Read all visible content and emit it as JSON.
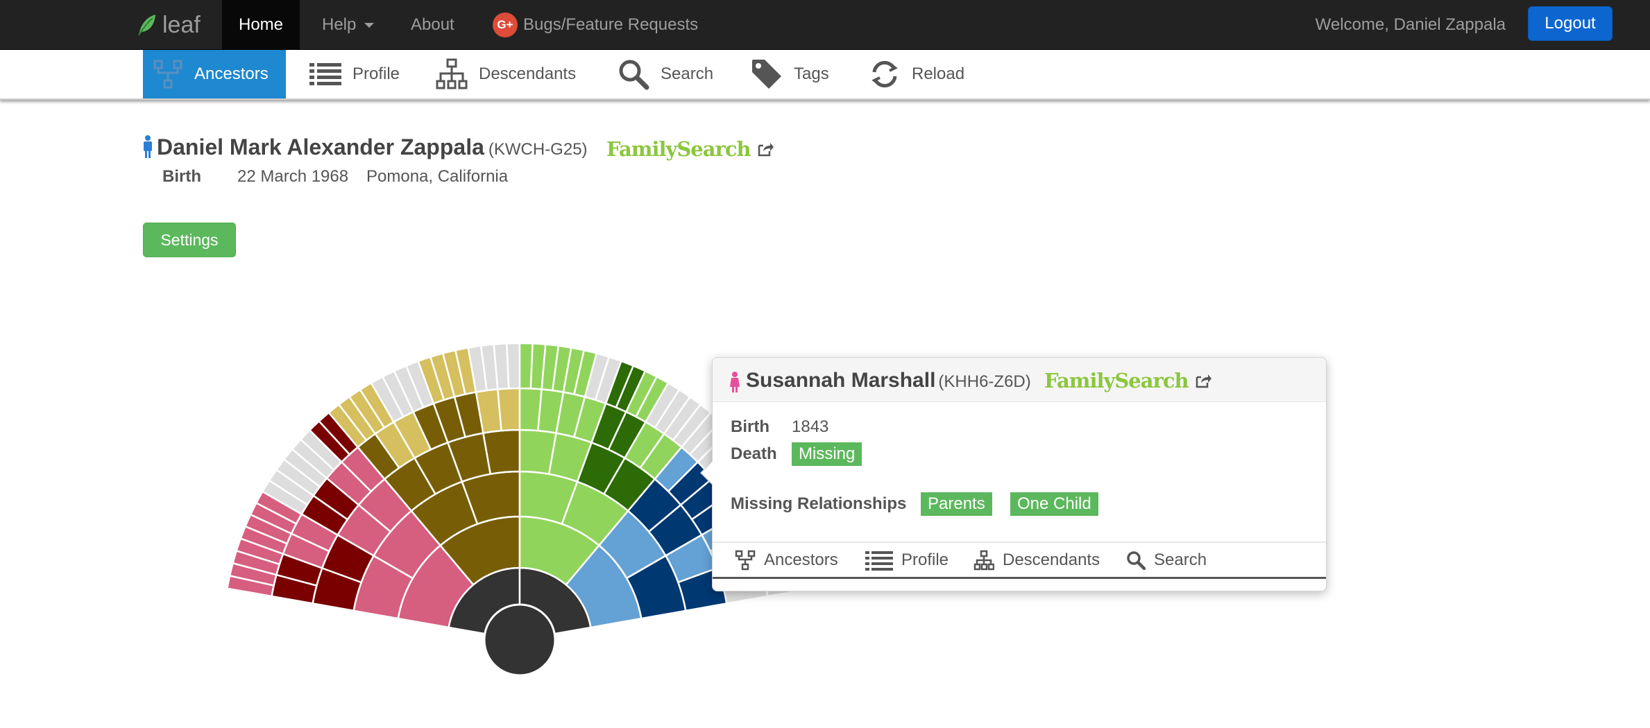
{
  "navbar": {
    "brand": "leaf",
    "items": [
      {
        "label": "Home"
      },
      {
        "label": "Help"
      },
      {
        "label": "About"
      },
      {
        "label": "Bugs/Feature Requests"
      }
    ],
    "welcome": "Welcome, Daniel Zappala",
    "logout": "Logout"
  },
  "toolbar": {
    "items": [
      {
        "label": "Ancestors",
        "icon": "ancestors-icon",
        "active": true
      },
      {
        "label": "Profile",
        "icon": "list-icon"
      },
      {
        "label": "Descendants",
        "icon": "sitemap-icon"
      },
      {
        "label": "Search",
        "icon": "search-icon"
      },
      {
        "label": "Tags",
        "icon": "tag-icon"
      },
      {
        "label": "Reload",
        "icon": "reload-icon"
      }
    ]
  },
  "person": {
    "name": "Daniel Mark Alexander Zappala",
    "id": "(KWCH-G25)",
    "familysearch": "FamilySearch",
    "birth_label": "Birth",
    "birth_date": "22 March 1968",
    "birth_place": "Pomona, California"
  },
  "settings_label": "Settings",
  "popup": {
    "name": "Susannah Marshall",
    "id": "(KHH6-Z6D)",
    "familysearch": "FamilySearch",
    "birth_label": "Birth",
    "birth_value": "1843",
    "death_label": "Death",
    "death_value": "Missing",
    "missing_label": "Missing Relationships",
    "missing": [
      "Parents",
      "One Child"
    ],
    "actions": [
      {
        "label": "Ancestors"
      },
      {
        "label": "Profile"
      },
      {
        "label": "Descendants"
      },
      {
        "label": "Search"
      }
    ]
  },
  "colors": {
    "navbar": "#222222",
    "active_tab": "#1e88d0",
    "success": "#5cb85c",
    "familysearch": "#8cc63e",
    "male": "#2a7fd4",
    "female": "#e84f9a",
    "center": "#333333",
    "unknown": "#dddddd"
  },
  "fan": {
    "generations": 7,
    "palette": {
      "C": "#333333",
      "r1": "#d65e7f",
      "r2": "#7a0000",
      "o1": "#775e06",
      "o2": "#d5bf5e",
      "g1": "#91d45c",
      "g2": "#2c6b05",
      "b1": "#64a1d4",
      "b2": "#003872",
      "x": "#dddddd"
    },
    "rings": [
      [
        "C"
      ],
      [
        "C",
        "C"
      ],
      [
        "r1",
        "o1",
        "g1",
        "b1"
      ],
      [
        "r1",
        "r1",
        "o1",
        "o1",
        "g1",
        "g1",
        "b1",
        "b2"
      ],
      [
        "r2",
        "r2",
        "r1",
        "r1",
        "o1",
        "o1",
        "o1",
        "o1",
        "g1",
        "g1",
        "g2",
        "g2",
        "b2",
        "b2",
        "b1",
        "b2"
      ],
      [
        "r2",
        "r2",
        "r1",
        "r1",
        "r2",
        "r2",
        "r1",
        "r1",
        "o1",
        "o2",
        "o2",
        "o1",
        "o1",
        "o1",
        "o2",
        "o2",
        "g1",
        "g1",
        "g1",
        "g1",
        "g2",
        "g2",
        "g1",
        "g1",
        "b1",
        "b2",
        "b2",
        "b2",
        "b1",
        "b1",
        "x",
        "x"
      ],
      [
        "r1",
        "r1",
        "r1",
        "r1",
        "r1",
        "r1",
        "r1",
        "r1",
        "x",
        "x",
        "x",
        "x",
        "x",
        "x",
        "r2",
        "r2",
        "o2",
        "o2",
        "o2",
        "o2",
        "x",
        "x",
        "x",
        "x",
        "o2",
        "o2",
        "o2",
        "o2",
        "x",
        "x",
        "x",
        "x",
        "g1",
        "g1",
        "g1",
        "g1",
        "g1",
        "g1",
        "x",
        "x",
        "g2",
        "g2",
        "g1",
        "g1",
        "x",
        "x",
        "x",
        "x",
        "x",
        "x",
        "x",
        "x",
        "x",
        "x",
        "x",
        "x",
        "x",
        "x",
        "x",
        "x",
        "x",
        "x",
        "x",
        "x"
      ]
    ]
  }
}
